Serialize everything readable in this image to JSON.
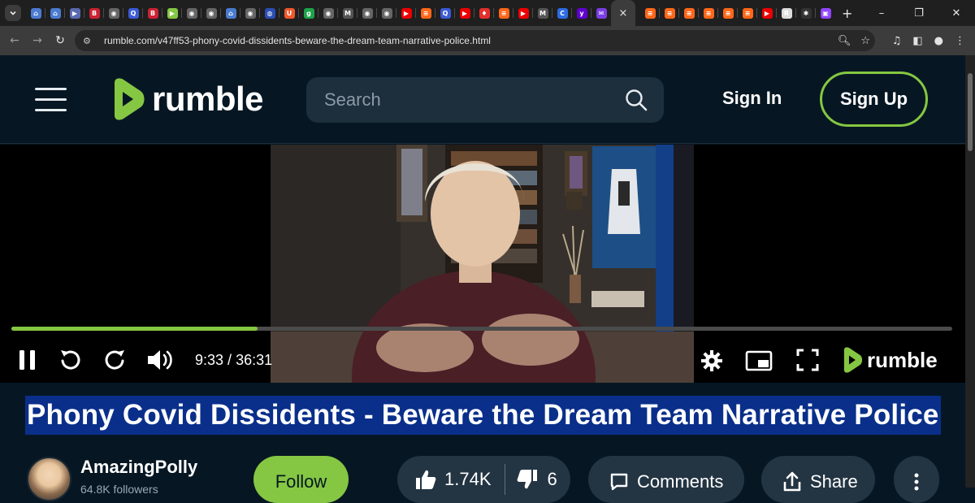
{
  "browser": {
    "tab_active_close": "×",
    "new_tab": "+",
    "url": "rumble.com/v47ff53-phony-covid-dissidents-beware-the-dream-team-narrative-police.html",
    "window_minimize": "–",
    "window_maximize": "❐",
    "window_close": "✕",
    "favicons": [
      {
        "icon": "shield-icon",
        "color": "#4a7bd0",
        "glyph": "⌂"
      },
      {
        "icon": "shield-icon",
        "color": "#4a7bd0",
        "glyph": "⌂"
      },
      {
        "icon": "bookmark-icon",
        "color": "#5a6ab0",
        "glyph": "▶"
      },
      {
        "icon": "b-letter-icon",
        "color": "#c23",
        "glyph": "B"
      },
      {
        "icon": "globe-icon",
        "color": "#666",
        "glyph": "◉"
      },
      {
        "icon": "search-icon",
        "color": "#3c5bd6",
        "glyph": "Q"
      },
      {
        "icon": "b-letter-icon",
        "color": "#c23",
        "glyph": "B"
      },
      {
        "icon": "rumble-icon",
        "color": "#85c742",
        "glyph": "▶"
      },
      {
        "icon": "globe-icon",
        "color": "#666",
        "glyph": "◉"
      },
      {
        "icon": "globe-icon",
        "color": "#666",
        "glyph": "◉"
      },
      {
        "icon": "shield-icon",
        "color": "#4a7bd0",
        "glyph": "⌂"
      },
      {
        "icon": "globe-icon",
        "color": "#666",
        "glyph": "◉"
      },
      {
        "icon": "sphere-icon",
        "color": "#2b4db5",
        "glyph": "◍"
      },
      {
        "icon": "brave-icon",
        "color": "#f0582c",
        "glyph": "U"
      },
      {
        "icon": "g-letter-icon",
        "color": "#1fa34a",
        "glyph": "g"
      },
      {
        "icon": "globe-icon",
        "color": "#666",
        "glyph": "◉"
      },
      {
        "icon": "italic-icon",
        "color": "#555",
        "glyph": "M"
      },
      {
        "icon": "globe-icon",
        "color": "#666",
        "glyph": "◉"
      },
      {
        "icon": "globe-icon",
        "color": "#666",
        "glyph": "◉"
      },
      {
        "icon": "youtube-icon",
        "color": "#e00",
        "glyph": "▶"
      },
      {
        "icon": "substack-icon",
        "color": "#ff6719",
        "glyph": "≡"
      },
      {
        "icon": "search-icon",
        "color": "#3c5bd6",
        "glyph": "Q"
      },
      {
        "icon": "youtube-icon",
        "color": "#e00",
        "glyph": "▶"
      },
      {
        "icon": "podcast-icon",
        "color": "#e4302b",
        "glyph": "♦"
      },
      {
        "icon": "substack-icon",
        "color": "#ff6719",
        "glyph": "≡"
      },
      {
        "icon": "youtube-icon",
        "color": "#e00",
        "glyph": "▶"
      },
      {
        "icon": "italic-icon",
        "color": "#555",
        "glyph": "M"
      },
      {
        "icon": "c-letter-icon",
        "color": "#2d6be4",
        "glyph": "C"
      },
      {
        "icon": "yahoo-icon",
        "color": "#6001d2",
        "glyph": "y"
      },
      {
        "icon": "mail-icon",
        "color": "#7b3fe4",
        "glyph": "✉"
      }
    ],
    "favicons_after": [
      {
        "icon": "substack-icon",
        "color": "#ff6719",
        "glyph": "≡"
      },
      {
        "icon": "substack-icon",
        "color": "#ff6719",
        "glyph": "≡"
      },
      {
        "icon": "substack-icon",
        "color": "#ff6719",
        "glyph": "≡"
      },
      {
        "icon": "substack-icon",
        "color": "#ff6719",
        "glyph": "≡"
      },
      {
        "icon": "substack-icon",
        "color": "#ff6719",
        "glyph": "≡"
      },
      {
        "icon": "substack-icon",
        "color": "#ff6719",
        "glyph": "≡"
      },
      {
        "icon": "youtube-icon",
        "color": "#e00",
        "glyph": "▶"
      },
      {
        "icon": "r-letter-icon",
        "color": "#ddd",
        "glyph": "R"
      },
      {
        "icon": "bug-icon",
        "color": "#333",
        "glyph": "✱"
      },
      {
        "icon": "twitch-icon",
        "color": "#9146ff",
        "glyph": "▣"
      }
    ]
  },
  "header": {
    "logo_text": "rumble",
    "search_placeholder": "Search",
    "sign_in": "Sign In",
    "sign_up": "Sign Up",
    "accent_color": "#85c742"
  },
  "player": {
    "current_time": "9:33",
    "separator": " / ",
    "duration": "36:31",
    "progress_fraction": 0.2613,
    "logo_text": "rumble"
  },
  "video": {
    "title": "Phony Covid Dissidents - Beware the Dream Team Narrative Police",
    "channel": "AmazingPolly",
    "followers": "64.8K followers",
    "follow_label": "Follow",
    "likes": "1.74K",
    "dislikes": "6",
    "comments_label": "Comments",
    "share_label": "Share"
  }
}
